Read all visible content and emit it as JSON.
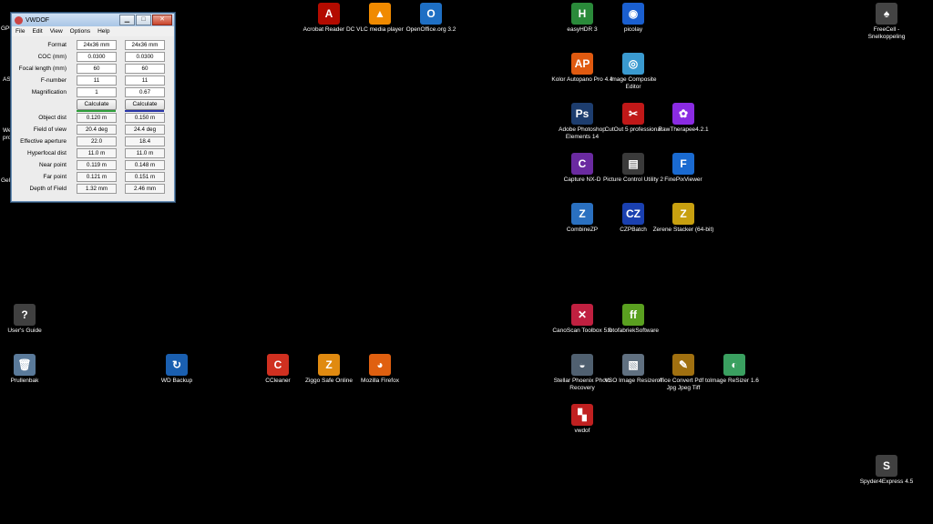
{
  "vwdof_window": {
    "title": "VWDOF",
    "minimize_glyph": "▁",
    "maximize_glyph": "□",
    "close_glyph": "✕",
    "menu": [
      "File",
      "Edit",
      "View",
      "Options",
      "Help"
    ],
    "input_rows": [
      {
        "label": "Format",
        "v1": "24x36 mm",
        "v2": "24x36 mm"
      },
      {
        "label": "COC (mm)",
        "v1": "0.0300",
        "v2": "0.0300"
      },
      {
        "label": "Focal length (mm)",
        "v1": "60",
        "v2": "60"
      },
      {
        "label": "F-number",
        "v1": "11",
        "v2": "11"
      },
      {
        "label": "Magnification",
        "v1": "1",
        "v2": "0.67"
      }
    ],
    "calculate_label": "Calculate",
    "calc_bar_colors": [
      "#2e9e3a",
      "#2a36a8"
    ],
    "output_rows": [
      {
        "label": "Object dist",
        "v1": "0.120 m",
        "v2": "0.150 m"
      },
      {
        "label": "Field of view",
        "v1": "20.4 deg",
        "v2": "24.4 deg"
      },
      {
        "label": "Effective aperture",
        "v1": "22.0",
        "v2": "18.4"
      },
      {
        "label": "Hyperfocal dist",
        "v1": "11.0 m",
        "v2": "11.0 m"
      },
      {
        "label": "Near point",
        "v1": "0.119 m",
        "v2": "0.148 m"
      },
      {
        "label": "Far point",
        "v1": "0.121 m",
        "v2": "0.151 m"
      },
      {
        "label": "Depth of Field",
        "v1": "1.32 mm",
        "v2": "2.46 mm"
      }
    ]
  },
  "left_edge_text": [
    "GPU",
    "AS",
    "We",
    "pro",
    "Gel"
  ],
  "desktop_icons": [
    {
      "name": "acrobat",
      "label": "Acrobat Reader DC",
      "color": "#b30b00",
      "glyph": "A"
    },
    {
      "name": "vlc",
      "label": "VLC media player",
      "color": "#f08a00",
      "glyph": "▲"
    },
    {
      "name": "openoffice",
      "label": "OpenOffice.org 3.2",
      "color": "#1e6fc4",
      "glyph": "O"
    },
    {
      "name": "easyhdr",
      "label": "easyHDR 3",
      "color": "#2a8a3a",
      "glyph": "H"
    },
    {
      "name": "picolay",
      "label": "picolay",
      "color": "#1a5fd0",
      "glyph": "◉"
    },
    {
      "name": "freecell",
      "label": "FreeCell - Snelkoppeling",
      "color": "#444444",
      "glyph": "♠"
    },
    {
      "name": "kolor",
      "label": "Kolor Autopano Pro 4.4",
      "color": "#e05a10",
      "glyph": "AP"
    },
    {
      "name": "ice",
      "label": "Image Composite Editor",
      "color": "#3a9ad0",
      "glyph": "◎"
    },
    {
      "name": "photoshop-elements",
      "label": "Adobe Photoshop Elements 14",
      "color": "#1d3d6e",
      "glyph": "Ps"
    },
    {
      "name": "cutout",
      "label": "CutOut 5 professional",
      "color": "#c01818",
      "glyph": "✂"
    },
    {
      "name": "rawtherapee",
      "label": "RawTherapee4.2.1",
      "color": "#8a2be2",
      "glyph": "✿"
    },
    {
      "name": "capture-nxd",
      "label": "Capture NX-D",
      "color": "#6a2aa0",
      "glyph": "C"
    },
    {
      "name": "picture-control",
      "label": "Picture Control Utility 2",
      "color": "#3a3a3a",
      "glyph": "▤"
    },
    {
      "name": "finepixviewer",
      "label": "FinePixViewer",
      "color": "#1a6ad0",
      "glyph": "F"
    },
    {
      "name": "combinezp",
      "label": "CombineZP",
      "color": "#2a70c0",
      "glyph": "Z"
    },
    {
      "name": "czpbatch",
      "label": "CZPBatch",
      "color": "#1a40b0",
      "glyph": "CZ"
    },
    {
      "name": "zerene",
      "label": "Zerene Stacker (64-bit)",
      "color": "#c8a010",
      "glyph": "Z"
    },
    {
      "name": "canoscan",
      "label": "CanoScan Toolbox 5.0",
      "color": "#c02040",
      "glyph": "✕"
    },
    {
      "name": "fotofabriek",
      "label": "fotofabriekSoftware",
      "color": "#5aa020",
      "glyph": "ff"
    },
    {
      "name": "stellar",
      "label": "Stellar Phoenix Photo Recovery",
      "color": "#506070",
      "glyph": "◒"
    },
    {
      "name": "vso",
      "label": "VSO Image Resizer 4",
      "color": "#607080",
      "glyph": "▧"
    },
    {
      "name": "office-convert",
      "label": "office Convert Pdf to Jpg Jpeg Tiff",
      "color": "#a07010",
      "glyph": "✎"
    },
    {
      "name": "image-resizer",
      "label": "Image ReSizer 1.6",
      "color": "#3aa060",
      "glyph": "◐"
    },
    {
      "name": "vwdof",
      "label": "vwdof",
      "color": "#c02020",
      "glyph": "▚"
    },
    {
      "name": "users-guide",
      "label": "User's Guide",
      "color": "#404040",
      "glyph": "?"
    },
    {
      "name": "prullenbak",
      "label": "Prullenbak",
      "color": "#5a7a9a",
      "glyph": "🗑"
    },
    {
      "name": "wd-backup",
      "label": "WD Backup",
      "color": "#1a5fb0",
      "glyph": "↻"
    },
    {
      "name": "ccleaner",
      "label": "CCleaner",
      "color": "#d03020",
      "glyph": "C"
    },
    {
      "name": "ziggo",
      "label": "Ziggo Safe Online",
      "color": "#e08a10",
      "glyph": "Z"
    },
    {
      "name": "firefox",
      "label": "Mozilla Firefox",
      "color": "#e06010",
      "glyph": "◕"
    },
    {
      "name": "spyder",
      "label": "Spyder4Express 4.5",
      "color": "#404040",
      "glyph": "S"
    }
  ]
}
